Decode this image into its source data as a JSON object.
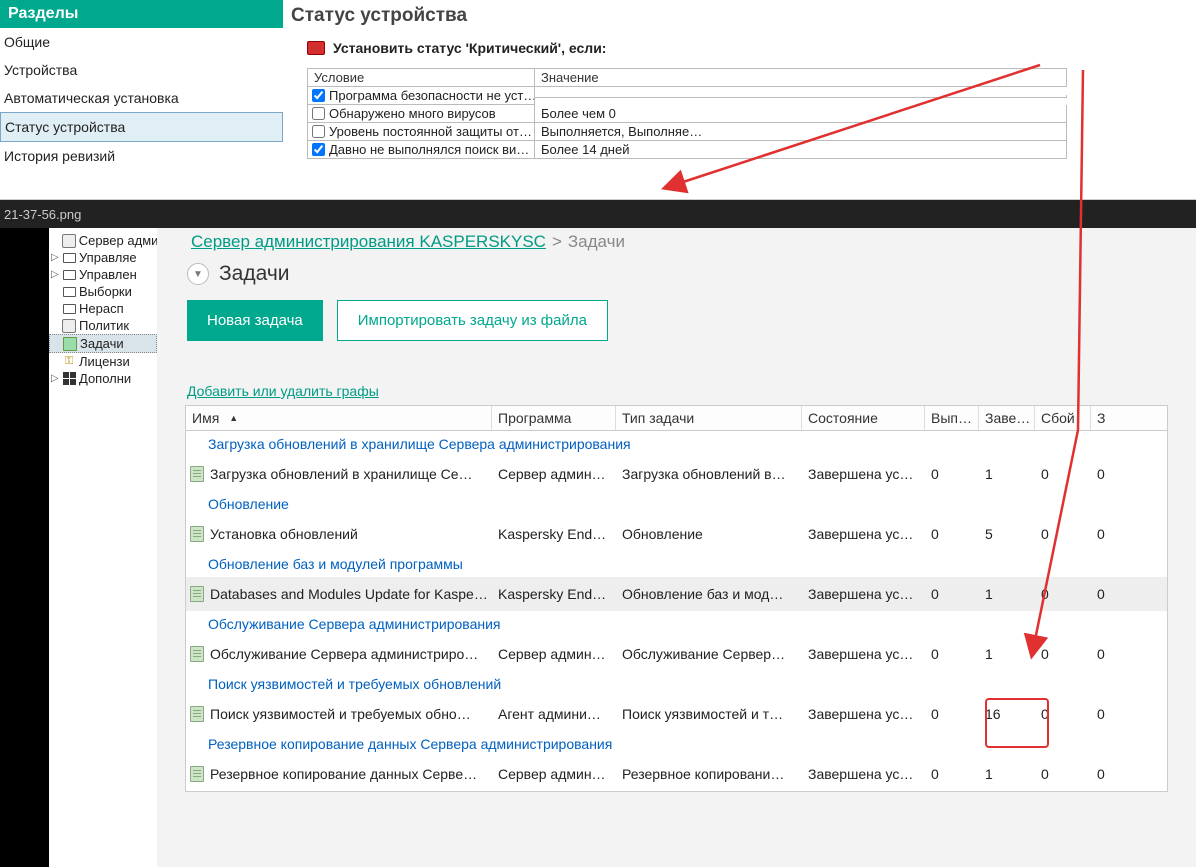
{
  "sections": {
    "title": "Разделы",
    "items": [
      "Общие",
      "Устройства",
      "Автоматическая установка",
      "Статус устройства",
      "История ревизий"
    ],
    "active_index": 3
  },
  "status": {
    "title": "Статус устройства",
    "header": "Установить статус 'Критический', если:",
    "cols": {
      "condition": "Условие",
      "value": "Значение"
    },
    "rows": [
      {
        "checked": true,
        "label": "Программа безопасности не уст…",
        "value": ""
      },
      {
        "checked": false,
        "label": "Обнаружено много вирусов",
        "value": "Более чем 0"
      },
      {
        "checked": false,
        "label": "Уровень постоянной защиты от…",
        "value": "Выполняется, Выполняе…"
      },
      {
        "checked": true,
        "label": "Давно не выполнялся поиск ви…",
        "value": "Более 14 дней"
      }
    ]
  },
  "darkbar": {
    "filename": "21-37-56.png"
  },
  "tree": {
    "items": [
      {
        "arrow": false,
        "icon": "server",
        "label": "Сервер адми"
      },
      {
        "arrow": true,
        "icon": "monitor",
        "label": "Управляе"
      },
      {
        "arrow": true,
        "icon": "monitor",
        "label": "Управлен"
      },
      {
        "arrow": false,
        "icon": "monitor",
        "label": "Выборки"
      },
      {
        "arrow": false,
        "icon": "monitor",
        "label": "Нерасп"
      },
      {
        "arrow": false,
        "icon": "server",
        "label": "Политик"
      },
      {
        "arrow": false,
        "icon": "clip",
        "label": "Задачи",
        "selected": true
      },
      {
        "arrow": false,
        "icon": "key",
        "label": "Лицензи"
      },
      {
        "arrow": true,
        "icon": "grid",
        "label": "Дополни"
      }
    ]
  },
  "breadcrumb": {
    "link": "Сервер администрирования KASPERSKYSC",
    "current": "Задачи"
  },
  "heading": "Задачи",
  "buttons": {
    "new_task": "Новая задача",
    "import_task": "Импортировать задачу из файла"
  },
  "columns_link": "Добавить или удалить графы",
  "table": {
    "head": {
      "name": "Имя",
      "prog": "Программа",
      "type": "Тип задачи",
      "state": "Состояние",
      "run": "Вып…",
      "done": "Заве…",
      "fail": "Сбой",
      "z": "З"
    },
    "groups": [
      {
        "title": "Загрузка обновлений в хранилище Сервера администрирования",
        "rows": [
          {
            "name": "Загрузка обновлений в хранилище Се…",
            "prog": "Сервер админ…",
            "type": "Загрузка обновлений в…",
            "state": "Завершена ус…",
            "run": "0",
            "done": "1",
            "fail": "0",
            "z": "0"
          }
        ]
      },
      {
        "title": "Обновление",
        "rows": [
          {
            "name": "Установка обновлений",
            "prog": "Kaspersky End…",
            "type": "Обновление",
            "state": "Завершена ус…",
            "run": "0",
            "done": "5",
            "fail": "0",
            "z": "0"
          }
        ]
      },
      {
        "title": "Обновление баз и модулей программы",
        "rows": [
          {
            "name": "Databases and Modules Update for Kaspe…",
            "prog": "Kaspersky End…",
            "type": "Обновление баз и мод…",
            "state": "Завершена ус…",
            "run": "0",
            "done": "1",
            "fail": "0",
            "z": "0",
            "highlight": true
          }
        ]
      },
      {
        "title": "Обслуживание Сервера администрирования",
        "rows": [
          {
            "name": "Обслуживание Сервера администриро…",
            "prog": "Сервер админ…",
            "type": "Обслуживание Сервер…",
            "state": "Завершена ус…",
            "run": "0",
            "done": "1",
            "fail": "0",
            "z": "0"
          }
        ]
      },
      {
        "title": "Поиск уязвимостей и требуемых обновлений",
        "rows": [
          {
            "name": "Поиск уязвимостей и требуемых обно…",
            "prog": "Агент админи…",
            "type": "Поиск уязвимостей и т…",
            "state": "Завершена ус…",
            "run": "0",
            "done": "16",
            "fail": "0",
            "z": "0"
          }
        ]
      },
      {
        "title": "Резервное копирование данных Сервера администрирования",
        "rows": [
          {
            "name": "Резервное копирование данных Серве…",
            "prog": "Сервер админ…",
            "type": "Резервное копировани…",
            "state": "Завершена ус…",
            "run": "0",
            "done": "1",
            "fail": "0",
            "z": "0"
          }
        ]
      }
    ]
  }
}
